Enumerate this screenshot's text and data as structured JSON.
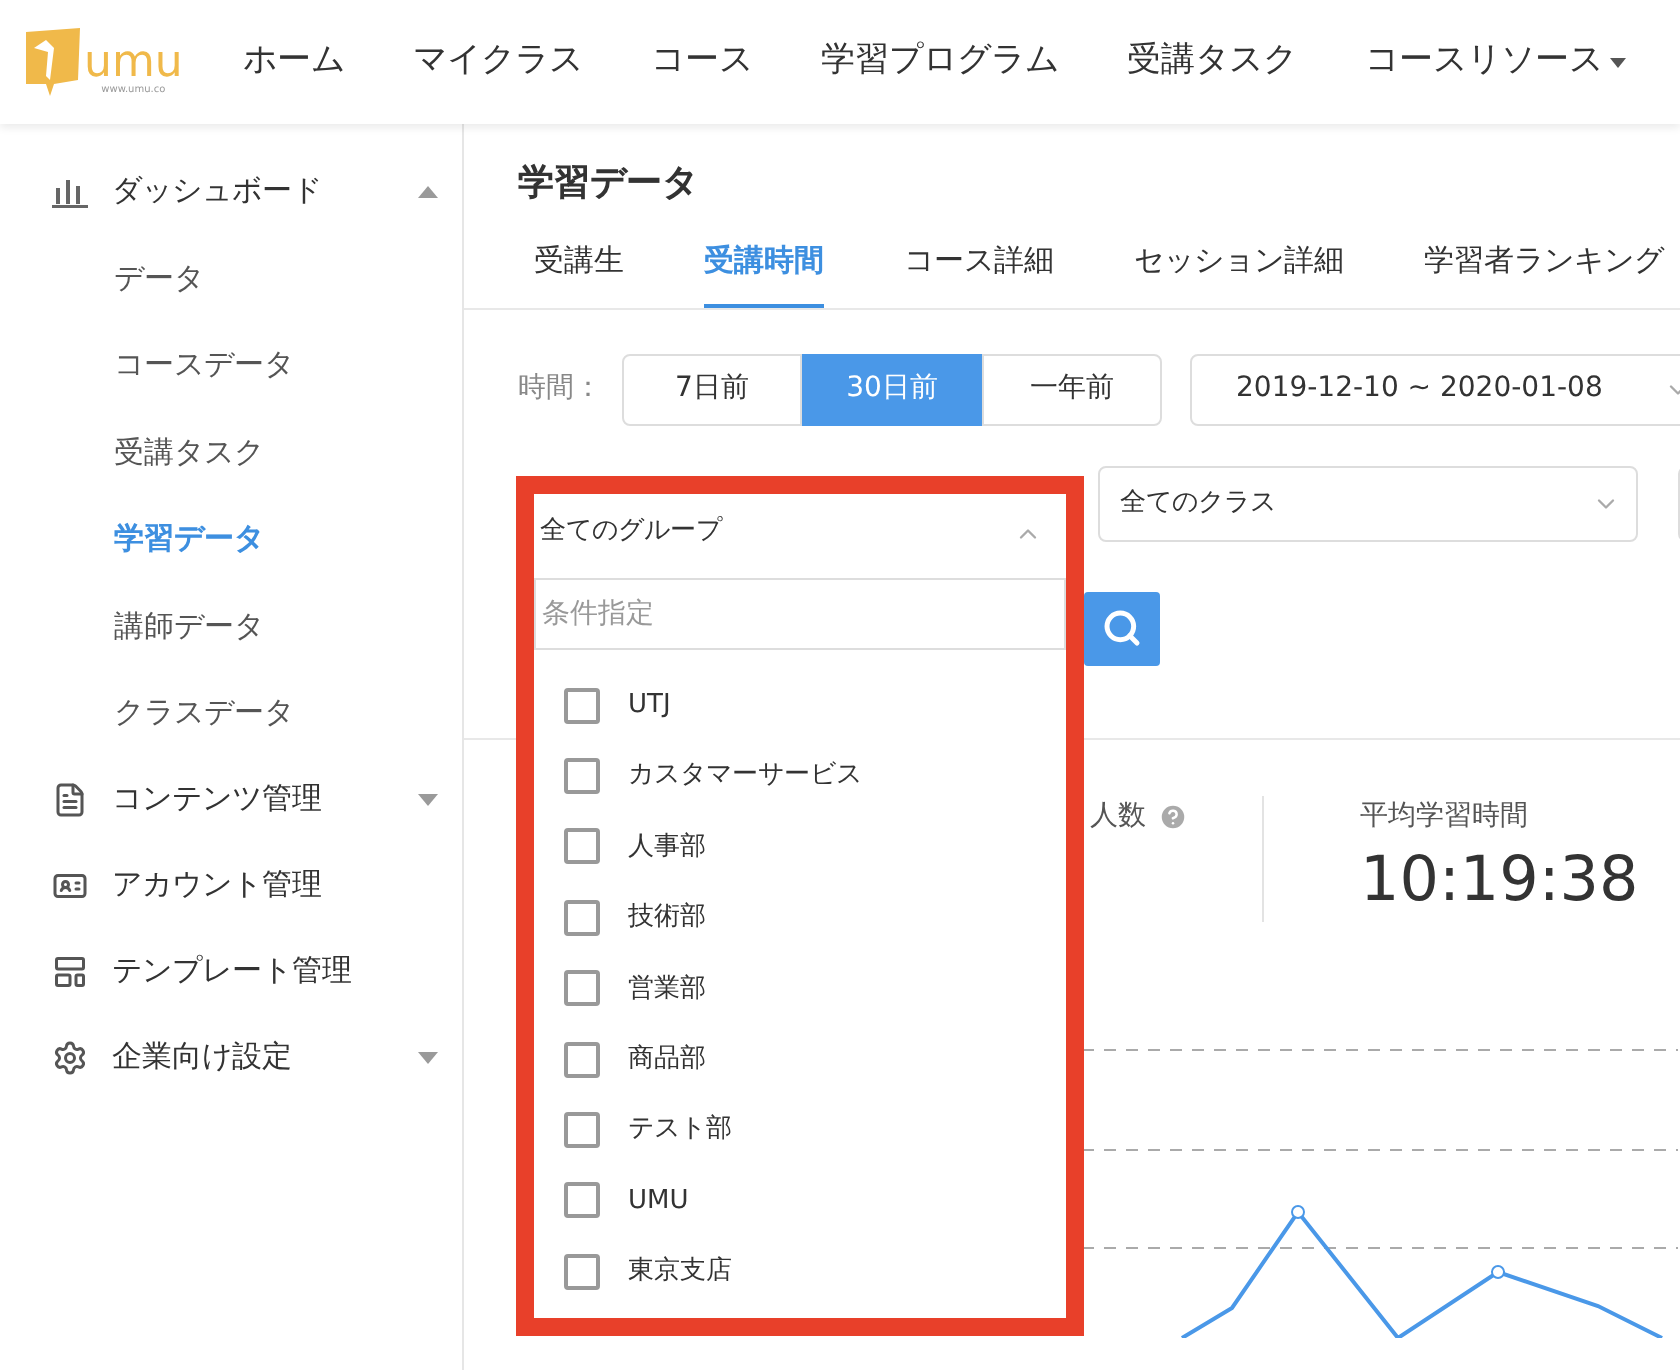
{
  "logo": {
    "text": "umu",
    "url": "www.umu.co"
  },
  "nav": [
    {
      "label": "ホーム",
      "dropdown": false
    },
    {
      "label": "マイクラス",
      "dropdown": false
    },
    {
      "label": "コース",
      "dropdown": false
    },
    {
      "label": "学習プログラム",
      "dropdown": false
    },
    {
      "label": "受講タスク",
      "dropdown": false
    },
    {
      "label": "コースリソース",
      "dropdown": true
    }
  ],
  "sidebar": {
    "items": [
      {
        "label": "ダッシュボード",
        "kind": "chart",
        "expanded": true,
        "children": [
          {
            "label": "データ",
            "selected": false
          },
          {
            "label": "コースデータ",
            "selected": false
          },
          {
            "label": "受講タスク",
            "selected": false
          },
          {
            "label": "学習データ",
            "selected": true
          },
          {
            "label": "講師データ",
            "selected": false
          },
          {
            "label": "クラスデータ",
            "selected": false
          }
        ]
      },
      {
        "label": "コンテンツ管理",
        "kind": "file",
        "expanded": false
      },
      {
        "label": "アカウント管理",
        "kind": "id"
      },
      {
        "label": "テンプレート管理",
        "kind": "template"
      },
      {
        "label": "企業向け設定",
        "kind": "gear",
        "expanded": false
      }
    ]
  },
  "page": {
    "title": "学習データ",
    "tabs": [
      {
        "label": "受講生",
        "selected": false
      },
      {
        "label": "受講時間",
        "selected": true
      },
      {
        "label": "コース詳細",
        "selected": false
      },
      {
        "label": "セッション詳細",
        "selected": false
      },
      {
        "label": "学習者ランキング",
        "selected": false
      }
    ]
  },
  "filters": {
    "time_label": "時間：",
    "ranges": [
      {
        "label": "7日前",
        "selected": false
      },
      {
        "label": "30日前",
        "selected": true
      },
      {
        "label": "一年前",
        "selected": false
      }
    ],
    "date_range": "2019-12-10 ~ 2020-01-08",
    "class_select": "全てのクラス"
  },
  "group_dropdown": {
    "value": "全てのグループ",
    "expanded": true,
    "placeholder": "条件指定",
    "options": [
      {
        "label": "UTJ",
        "checked": false
      },
      {
        "label": "カスタマーサービス",
        "checked": false
      },
      {
        "label": "人事部",
        "checked": false
      },
      {
        "label": "技術部",
        "checked": false
      },
      {
        "label": "営業部",
        "checked": false
      },
      {
        "label": "商品部",
        "checked": false
      },
      {
        "label": "テスト部",
        "checked": false
      },
      {
        "label": "UMU",
        "checked": false
      },
      {
        "label": "東京支店",
        "checked": false
      }
    ]
  },
  "stats": [
    {
      "label": "人数",
      "help": true
    },
    {
      "label": "平均学習時間",
      "help": false,
      "value": "10:19:38"
    }
  ]
}
